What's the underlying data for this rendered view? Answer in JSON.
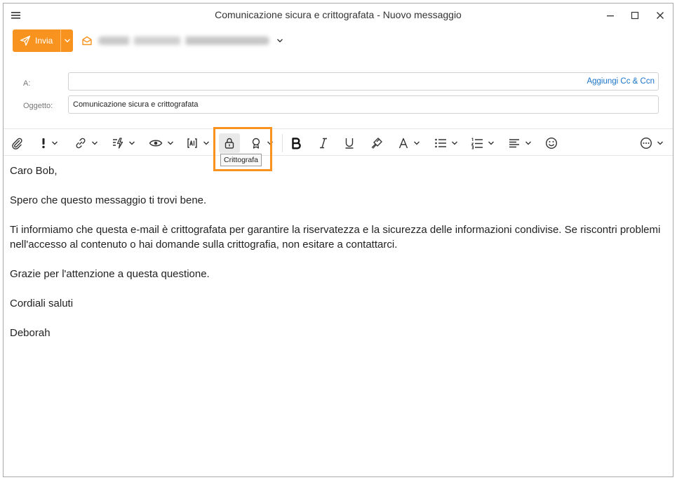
{
  "window": {
    "title": "Comunicazione sicura e crittografata - Nuovo messaggio"
  },
  "send": {
    "label": "Invia"
  },
  "fields": {
    "to_label": "A:",
    "to_value": "",
    "cc_link": "Aggiungi Cc & Ccn",
    "subject_label": "Oggetto:",
    "subject_value": "Comunicazione sicura e crittografata"
  },
  "toolbar": {
    "items": [
      "paperclip-icon",
      "importance-icon",
      "link-icon",
      "quick-text-icon",
      "eye-icon",
      "ai-icon",
      "lock-icon",
      "ribbon-icon",
      "bold-icon",
      "italic-icon",
      "underline-icon",
      "format-painter-icon",
      "font-color-icon",
      "bullet-list-icon",
      "numbered-list-icon",
      "align-icon",
      "emoji-icon",
      "more-icon"
    ],
    "tooltip": "Crittografa",
    "highlight_color": "#f7931e"
  },
  "body": {
    "greeting": "Caro Bob,",
    "p1": "Spero che questo messaggio ti trovi bene.",
    "p2": "Ti informiamo che questa e-mail è crittografata per garantire la riservatezza e la sicurezza delle informazioni condivise. Se riscontri problemi nell'accesso al contenuto o hai domande sulla crittografia, non esitare a contattarci.",
    "p3": "Grazie per l'attenzione a questa questione.",
    "closing": "Cordiali saluti",
    "signature": "Deborah"
  },
  "colors": {
    "accent": "#f7931e",
    "link": "#1a73c9"
  }
}
